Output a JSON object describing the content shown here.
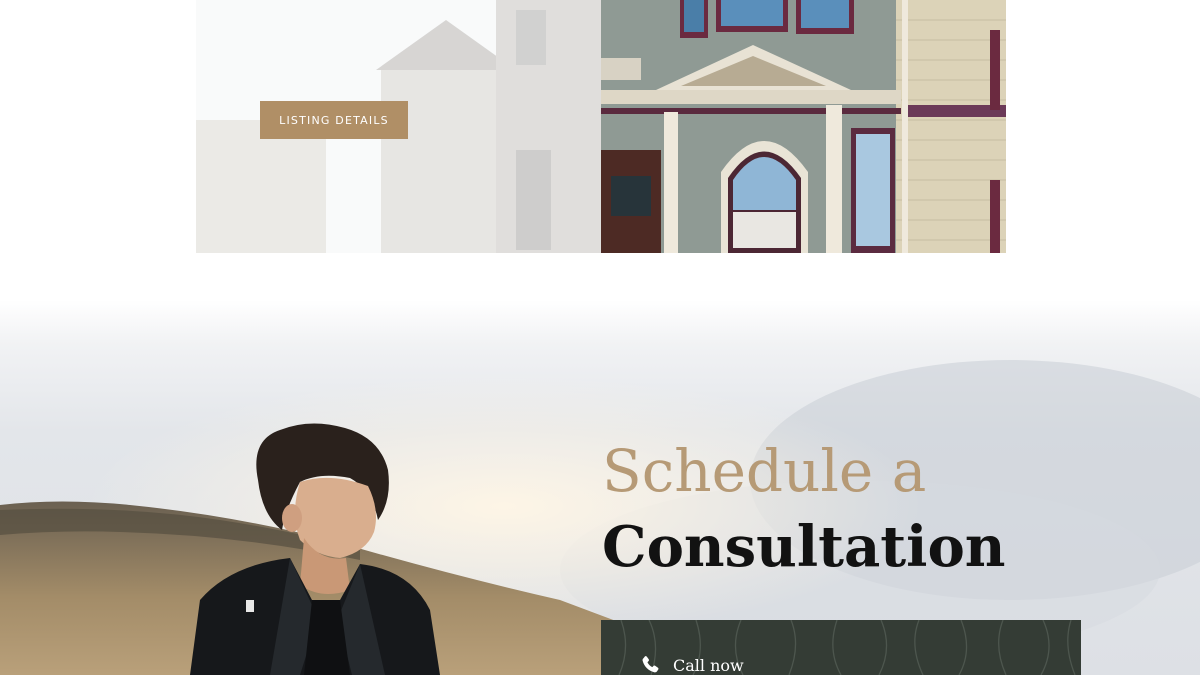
{
  "listing": {
    "button_label": "LISTING DETAILS"
  },
  "consultation": {
    "title_line1": "Schedule a",
    "title_line2": "Consultation",
    "call_label": "Call now",
    "call_icon": "phone-icon"
  },
  "colors": {
    "accent_gold": "#b08f66",
    "title_gold": "#b69a76",
    "dark_green": "#343c35",
    "title_dark": "#121212"
  }
}
